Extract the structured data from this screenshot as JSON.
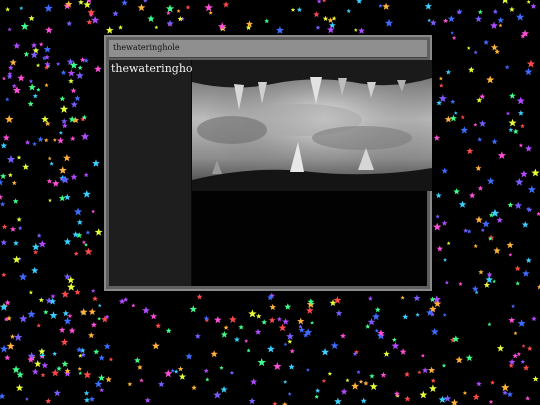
{
  "window": {
    "title": "thewateringhole"
  },
  "sidebar": {
    "site_name": "thewateringhole"
  },
  "main": {
    "image_icon": "crocodile-jaws-photo"
  },
  "colors": {
    "background": "#000000",
    "window_frame": "#5f5f5f",
    "titlebar": "#8f8f8f",
    "sidebar": "#1e1e1e",
    "content": "#020202"
  }
}
